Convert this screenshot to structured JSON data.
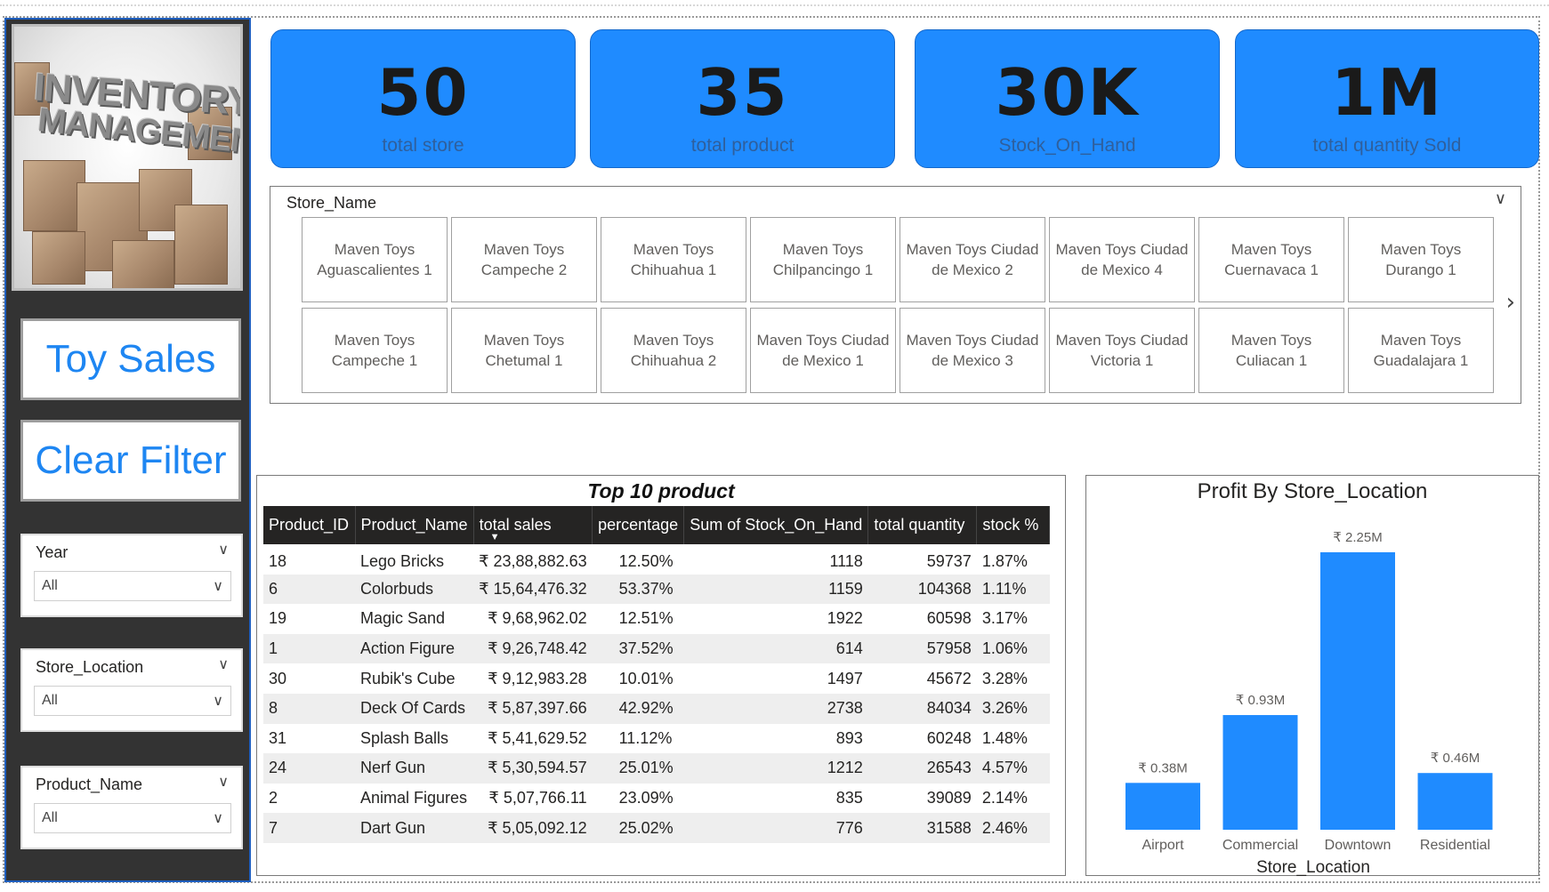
{
  "sidebar": {
    "logo": {
      "line1": "INVENTORY",
      "line2": "MANAGEMENT"
    },
    "buttons": {
      "toy_sales": "Toy Sales",
      "clear_filter": "Clear Filter"
    },
    "slicers": [
      {
        "title": "Year",
        "value": "All"
      },
      {
        "title": "Store_Location",
        "value": "All"
      },
      {
        "title": "Product_Name",
        "value": "All"
      }
    ]
  },
  "kpis": [
    {
      "value": "50",
      "label": "total store"
    },
    {
      "value": "35",
      "label": "total product"
    },
    {
      "value": "30K",
      "label": "Stock_On_Hand"
    },
    {
      "value": "1M",
      "label": "total quantity Sold"
    }
  ],
  "store_slicer": {
    "title": "Store_Name",
    "tiles": [
      "Maven Toys Aguascalientes 1",
      "Maven Toys Campeche 2",
      "Maven Toys Chihuahua 1",
      "Maven Toys Chilpancingo 1",
      "Maven Toys Ciudad de Mexico 2",
      "Maven Toys Ciudad de Mexico 4",
      "Maven Toys Cuernavaca 1",
      "Maven Toys Durango 1",
      "Maven Toys Campeche 1",
      "Maven Toys Chetumal 1",
      "Maven Toys Chihuahua 2",
      "Maven Toys Ciudad de Mexico 1",
      "Maven Toys Ciudad de Mexico 3",
      "Maven Toys Ciudad Victoria 1",
      "Maven Toys Culiacan 1",
      "Maven Toys Guadalajara 1"
    ]
  },
  "table": {
    "title": "Top 10 product",
    "columns": [
      "Product_ID",
      "Product_Name",
      "total sales",
      "percentage",
      "Sum of Stock_On_Hand",
      "total quantity",
      "stock %"
    ],
    "rows": [
      [
        "18",
        "Lego Bricks",
        "₹ 23,88,882.63",
        "12.50%",
        "1118",
        "59737",
        "1.87%"
      ],
      [
        "6",
        "Colorbuds",
        "₹ 15,64,476.32",
        "53.37%",
        "1159",
        "104368",
        "1.11%"
      ],
      [
        "19",
        "Magic Sand",
        "₹ 9,68,962.02",
        "12.51%",
        "1922",
        "60598",
        "3.17%"
      ],
      [
        "1",
        "Action Figure",
        "₹ 9,26,748.42",
        "37.52%",
        "614",
        "57958",
        "1.06%"
      ],
      [
        "30",
        "Rubik's Cube",
        "₹ 9,12,983.28",
        "10.01%",
        "1497",
        "45672",
        "3.28%"
      ],
      [
        "8",
        "Deck Of Cards",
        "₹ 5,87,397.66",
        "42.92%",
        "2738",
        "84034",
        "3.26%"
      ],
      [
        "31",
        "Splash Balls",
        "₹ 5,41,629.52",
        "11.12%",
        "893",
        "60248",
        "1.48%"
      ],
      [
        "24",
        "Nerf Gun",
        "₹ 5,30,594.57",
        "25.01%",
        "1212",
        "26543",
        "4.57%"
      ],
      [
        "2",
        "Animal Figures",
        "₹ 5,07,766.11",
        "23.09%",
        "835",
        "39089",
        "2.14%"
      ],
      [
        "7",
        "Dart Gun",
        "₹ 5,05,092.12",
        "25.02%",
        "776",
        "31588",
        "2.46%"
      ]
    ]
  },
  "chart_data": {
    "type": "bar",
    "title": "Profit By Store_Location",
    "xlabel": "Store_Location",
    "ylabel": "",
    "categories": [
      "Airport",
      "Commercial",
      "Downtown",
      "Residential"
    ],
    "values": [
      0.38,
      0.93,
      2.25,
      0.46
    ],
    "data_labels": [
      "₹ 0.38M",
      "₹ 0.93M",
      "₹ 2.25M",
      "₹ 0.46M"
    ],
    "units": "M",
    "ylim": [
      0,
      2.25
    ],
    "grid": false,
    "bar_color": "#1f8bff"
  },
  "colors": {
    "accent": "#1f8bff",
    "sidebar_bg": "#333333",
    "header_bg": "#252423",
    "button_text": "#1e86f2"
  }
}
